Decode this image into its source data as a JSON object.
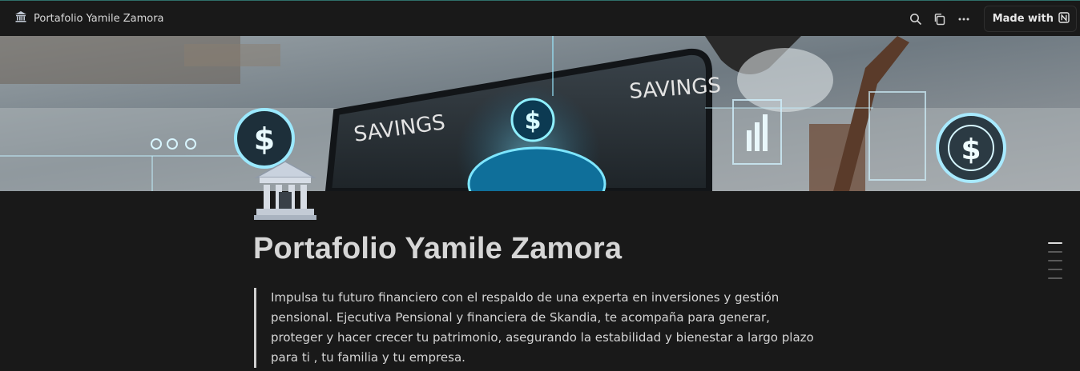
{
  "topbar": {
    "page_icon": "bank-icon",
    "breadcrumb_title": "Portafolio Yamile Zamora",
    "icons": [
      "search-icon",
      "duplicate-icon",
      "more-icon"
    ],
    "made_with_label": "Made with",
    "made_with_icon": "notion-logo-icon"
  },
  "cover": {
    "labels": [
      "SAVINGS",
      "SAVINGS"
    ],
    "currency_symbol": "$"
  },
  "page": {
    "icon": "bank-icon",
    "title": "Portafolio Yamile Zamora",
    "quote": "Impulsa tu futuro financiero con el respaldo de una experta en inversiones y gestión pensional. Ejecutiva Pensional y financiera de Skandia, te acompaña para generar, proteger y hacer crecer tu patrimonio, asegurando la estabilidad y bienestar a largo plazo para ti , tu familia y tu empresa."
  },
  "toc": {
    "items": 5,
    "active_index": 0
  },
  "colors": {
    "background": "#191919",
    "text": "#d4d4d4",
    "accent_cyan": "#39c6ff"
  }
}
